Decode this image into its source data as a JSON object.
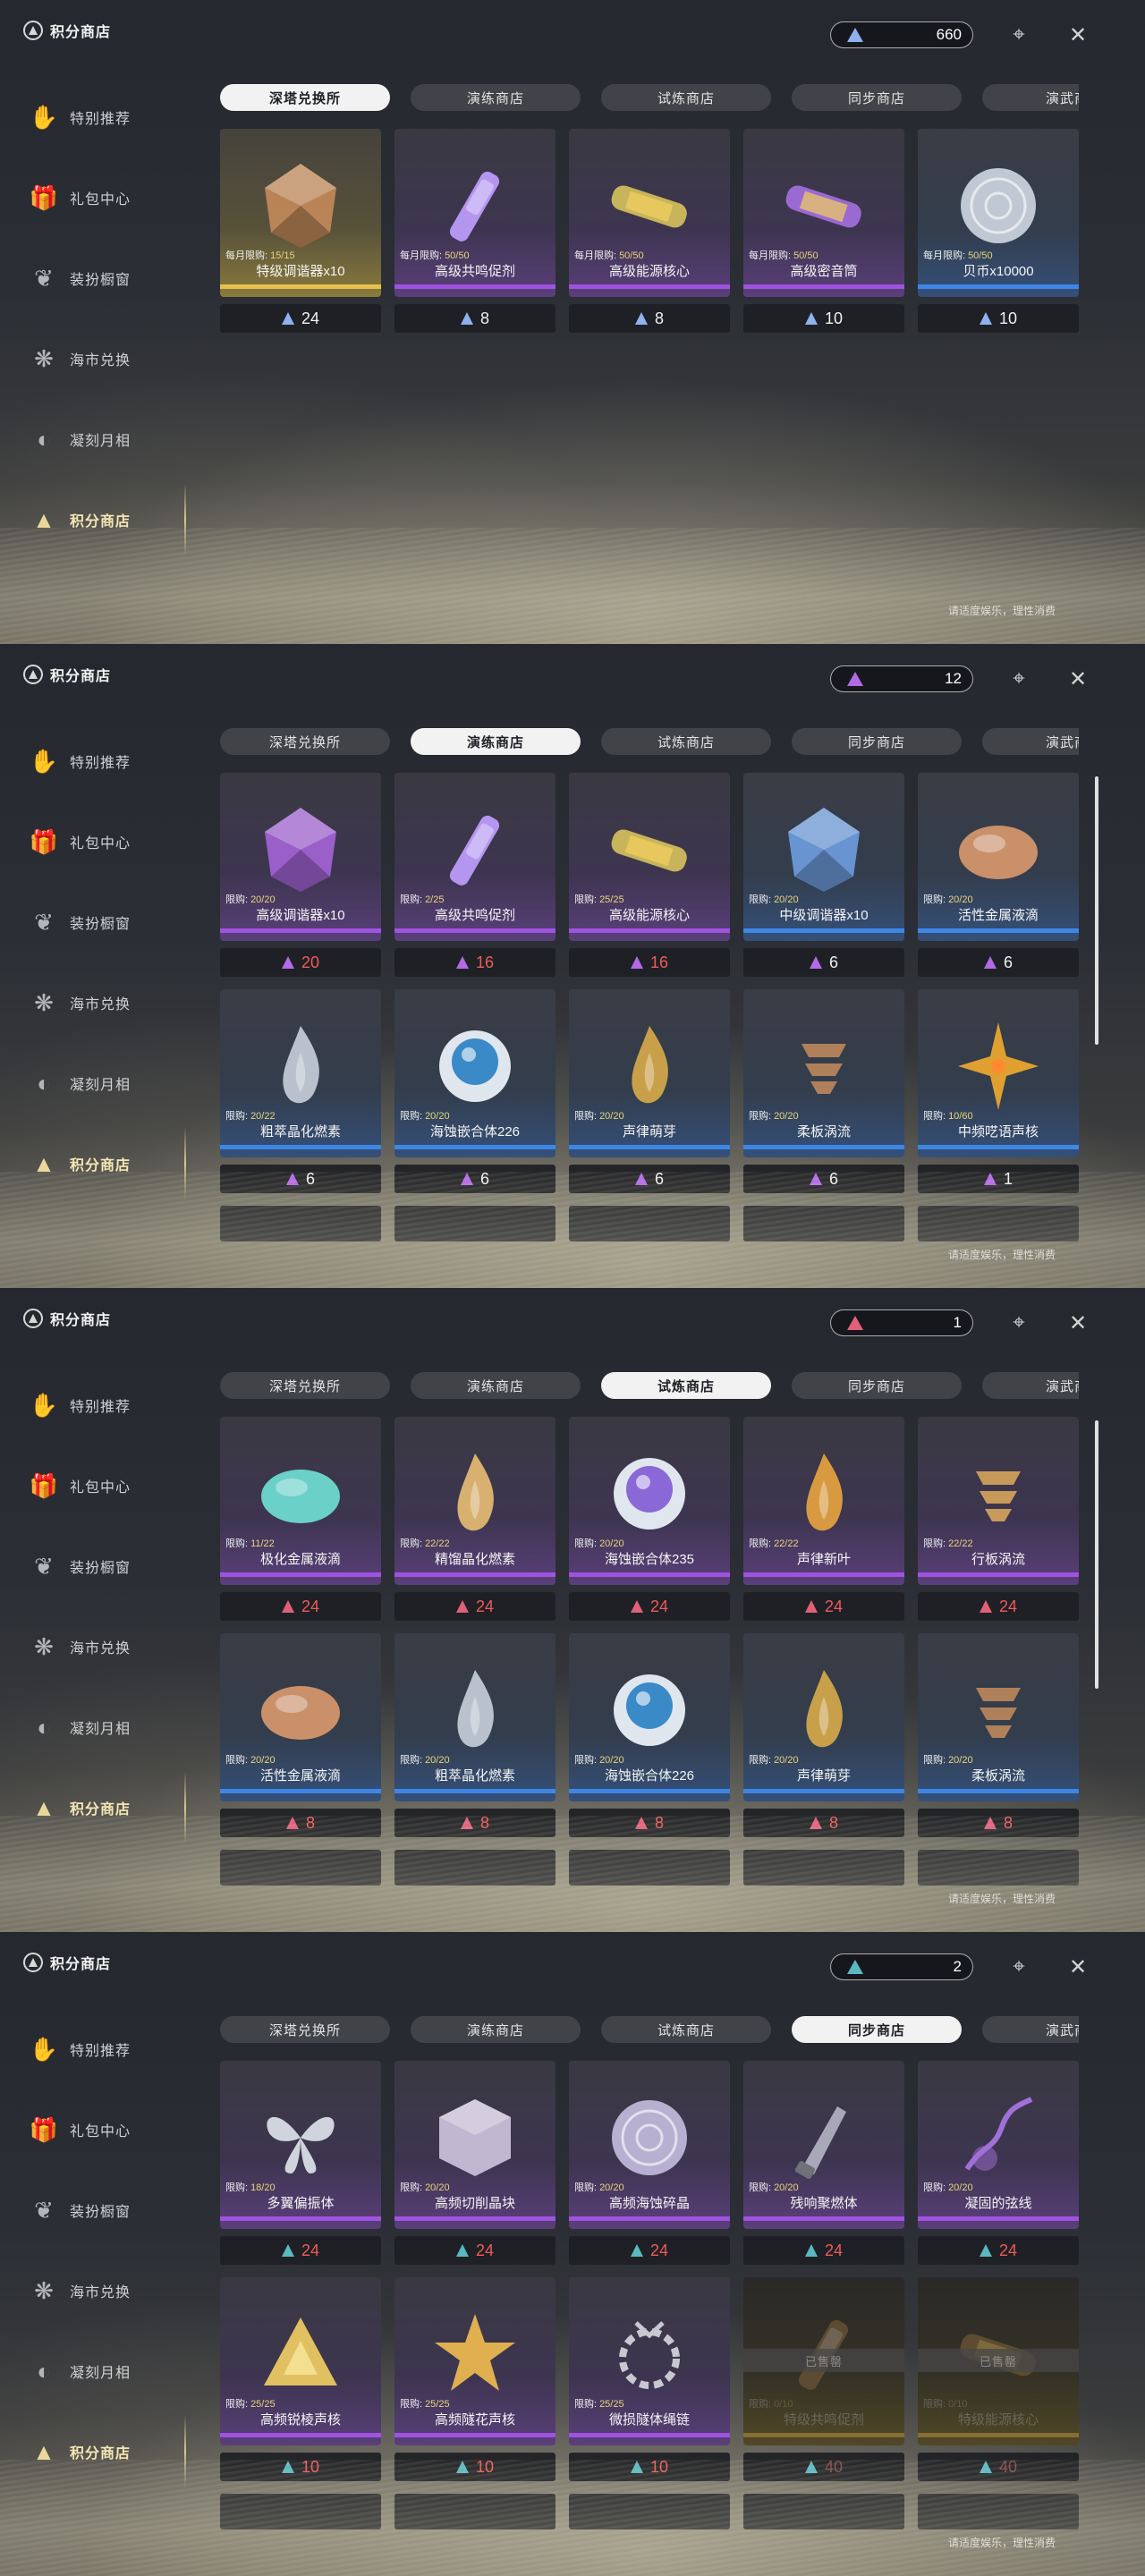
{
  "title": "积分商店",
  "sidebar": [
    {
      "label": "特别推荐",
      "icon": "hand-icon"
    },
    {
      "label": "礼包中心",
      "icon": "gift-icon"
    },
    {
      "label": "装扮橱窗",
      "icon": "outfit-icon"
    },
    {
      "label": "海市兑换",
      "icon": "coral-icon"
    },
    {
      "label": "凝刻月相",
      "icon": "moon-icon"
    },
    {
      "label": "积分商店",
      "icon": "triangle-emblem-icon",
      "active": true
    }
  ],
  "tabs": [
    "深塔兑换所",
    "演练商店",
    "试炼商店",
    "同步商店",
    "演武商"
  ],
  "footer_note": "请适度娱乐，理性消费",
  "screens": [
    {
      "currency": {
        "value": "660",
        "color": "#8fb2ee"
      },
      "active_tab": 0,
      "cards": [
        {
          "name": "特级调谐器x10",
          "limit_label": "每月限购:",
          "limit": "15/15",
          "price": "24",
          "rarity": "gold",
          "icon": "gold-tuner-icon",
          "icon_color": "#c48a5a"
        },
        {
          "name": "高级共鸣促剂",
          "limit_label": "每月限购:",
          "limit": "50/50",
          "price": "8",
          "rarity": "purple",
          "icon": "resonance-vial-icon",
          "icon_color": "#b496f0"
        },
        {
          "name": "高级能源核心",
          "limit_label": "每月限购:",
          "limit": "50/50",
          "price": "8",
          "rarity": "purple",
          "icon": "energy-core-icon",
          "icon_color": "#c8b45a"
        },
        {
          "name": "高级密音筒",
          "limit_label": "每月限购:",
          "limit": "50/50",
          "price": "10",
          "rarity": "purple",
          "icon": "sonic-tube-icon",
          "icon_color": "#9a6ad2"
        },
        {
          "name": "贝币x10000",
          "limit_label": "每月限购:",
          "limit": "50/50",
          "price": "10",
          "rarity": "blue",
          "icon": "shell-coin-icon",
          "icon_color": "#c0c8d4"
        }
      ],
      "price_color": "#8fb2ee",
      "price_red": false,
      "stub_row": false,
      "show_scroll": false
    },
    {
      "currency": {
        "value": "12",
        "color": "#b26ae6"
      },
      "active_tab": 1,
      "cards": [
        {
          "name": "高级调谐器x10",
          "limit_label": "限购:",
          "limit": "20/20",
          "price": "20",
          "rarity": "purple",
          "icon": "purple-tuner-icon",
          "icon_color": "#a564d8"
        },
        {
          "name": "高级共鸣促剂",
          "limit_label": "限购:",
          "limit": "2/25",
          "price": "16",
          "rarity": "purple",
          "icon": "resonance-vial-icon",
          "icon_color": "#b496f0"
        },
        {
          "name": "高级能源核心",
          "limit_label": "限购:",
          "limit": "25/25",
          "price": "16",
          "rarity": "purple",
          "icon": "energy-core-icon",
          "icon_color": "#c8b45a"
        },
        {
          "name": "中级调谐器x10",
          "limit_label": "限购:",
          "limit": "20/20",
          "price": "6",
          "rarity": "blue",
          "icon": "blue-tuner-icon",
          "icon_color": "#6e9ee0"
        },
        {
          "name": "活性金属液滴",
          "limit_label": "限购:",
          "limit": "20/20",
          "price": "6",
          "rarity": "blue",
          "icon": "metal-droplet-icon",
          "icon_color": "#c9906a"
        },
        {
          "name": "粗萃晶化燃素",
          "limit_label": "限购:",
          "limit": "20/22",
          "price": "6",
          "rarity": "blue",
          "icon": "crystal-flame-icon",
          "icon_color": "#b9c2cc"
        },
        {
          "name": "海蚀嵌合体226",
          "limit_label": "限购:",
          "limit": "20/20",
          "price": "6",
          "rarity": "blue",
          "icon": "chimera-orb-icon",
          "icon_color": "#3a8ac8"
        },
        {
          "name": "声律萌芽",
          "limit_label": "限购:",
          "limit": "20/20",
          "price": "6",
          "rarity": "blue",
          "icon": "sprout-icon",
          "icon_color": "#c8a04a"
        },
        {
          "name": "柔板涡流",
          "limit_label": "限购:",
          "limit": "20/20",
          "price": "6",
          "rarity": "blue",
          "icon": "vortex-icon",
          "icon_color": "#b0805a"
        },
        {
          "name": "中频呓语声核",
          "limit_label": "限购:",
          "limit": "10/60",
          "price": "1",
          "rarity": "blue",
          "icon": "star-core-icon",
          "icon_color": "#e0a030"
        }
      ],
      "price_color": "#b26ae6",
      "price_red": true,
      "price_red_first_n": 3,
      "stub_row": true,
      "show_scroll": true
    },
    {
      "currency": {
        "value": "1",
        "color": "#e0607a"
      },
      "active_tab": 2,
      "cards": [
        {
          "name": "极化金属液滴",
          "limit_label": "限购:",
          "limit": "11/22",
          "price": "24",
          "rarity": "purple",
          "icon": "iridescent-droplet-icon",
          "icon_color": "#6ad0c8"
        },
        {
          "name": "精馏晶化燃素",
          "limit_label": "限购:",
          "limit": "22/22",
          "price": "24",
          "rarity": "purple",
          "icon": "amber-flame-icon",
          "icon_color": "#d8b070"
        },
        {
          "name": "海蚀嵌合体235",
          "limit_label": "限购:",
          "limit": "20/20",
          "price": "24",
          "rarity": "purple",
          "icon": "purple-orb-icon",
          "icon_color": "#8a68d8"
        },
        {
          "name": "声律新叶",
          "limit_label": "限购:",
          "limit": "22/22",
          "price": "24",
          "rarity": "purple",
          "icon": "new-leaf-icon",
          "icon_color": "#d89a40"
        },
        {
          "name": "行板涡流",
          "limit_label": "限购:",
          "limit": "22/22",
          "price": "24",
          "rarity": "purple",
          "icon": "spiral-icon",
          "icon_color": "#c89a5a"
        },
        {
          "name": "活性金属液滴",
          "limit_label": "限购:",
          "limit": "20/20",
          "price": "8",
          "rarity": "blue",
          "icon": "metal-droplet-icon",
          "icon_color": "#c9906a"
        },
        {
          "name": "粗萃晶化燃素",
          "limit_label": "限购:",
          "limit": "20/20",
          "price": "8",
          "rarity": "blue",
          "icon": "crystal-flame-icon",
          "icon_color": "#b9c2cc"
        },
        {
          "name": "海蚀嵌合体226",
          "limit_label": "限购:",
          "limit": "20/20",
          "price": "8",
          "rarity": "blue",
          "icon": "chimera-orb-icon",
          "icon_color": "#3a8ac8"
        },
        {
          "name": "声律萌芽",
          "limit_label": "限购:",
          "limit": "20/20",
          "price": "8",
          "rarity": "blue",
          "icon": "sprout-icon",
          "icon_color": "#c8a04a"
        },
        {
          "name": "柔板涡流",
          "limit_label": "限购:",
          "limit": "20/20",
          "price": "8",
          "rarity": "blue",
          "icon": "vortex-icon",
          "icon_color": "#b0805a"
        }
      ],
      "price_color": "#e0607a",
      "price_red": true,
      "price_red_first_n": 10,
      "stub_row": true,
      "show_scroll": true
    },
    {
      "currency": {
        "value": "2",
        "color": "#5ab8c0"
      },
      "active_tab": 3,
      "cards": [
        {
          "name": "多翼偏振体",
          "limit_label": "限购:",
          "limit": "18/20",
          "price": "24",
          "rarity": "purple",
          "icon": "butterfly-icon",
          "icon_color": "#d0d4dc"
        },
        {
          "name": "高频切削晶块",
          "limit_label": "限购:",
          "limit": "20/20",
          "price": "24",
          "rarity": "purple",
          "icon": "crystal-cube-icon",
          "icon_color": "#c0b8d0"
        },
        {
          "name": "高频海蚀碎晶",
          "limit_label": "限购:",
          "limit": "20/20",
          "price": "24",
          "rarity": "purple",
          "icon": "shard-disc-icon",
          "icon_color": "#b8b0d0"
        },
        {
          "name": "残响聚燃体",
          "limit_label": "限购:",
          "limit": "20/20",
          "price": "24",
          "rarity": "purple",
          "icon": "blade-icon",
          "icon_color": "#a8a8b8"
        },
        {
          "name": "凝固的弦线",
          "limit_label": "限购:",
          "limit": "20/20",
          "price": "24",
          "rarity": "purple",
          "icon": "string-icon",
          "icon_color": "#a070d8"
        },
        {
          "name": "高频锐棱声核",
          "limit_label": "限购:",
          "limit": "25/25",
          "price": "10",
          "rarity": "purple",
          "icon": "prism-core-icon",
          "icon_color": "#e0c060"
        },
        {
          "name": "高频隧花声核",
          "limit_label": "限购:",
          "limit": "25/25",
          "price": "10",
          "rarity": "purple",
          "icon": "flower-core-icon",
          "icon_color": "#e0b050"
        },
        {
          "name": "微损隧体绳链",
          "limit_label": "限购:",
          "limit": "25/25",
          "price": "10",
          "rarity": "purple",
          "icon": "chain-icon",
          "icon_color": "#c8c8d0"
        },
        {
          "name": "特级共鸣促剂",
          "limit_label": "限购:",
          "limit": "0/10",
          "price": "40",
          "rarity": "gold",
          "icon": "gold-vial-icon",
          "icon_color": "#a08050",
          "sold_out": "已售罄"
        },
        {
          "name": "特级能源核心",
          "limit_label": "限购:",
          "limit": "0/10",
          "price": "40",
          "rarity": "gold",
          "icon": "gold-core-icon",
          "icon_color": "#a08050",
          "sold_out": "已售罄"
        }
      ],
      "price_color": "#5ab8c0",
      "price_red": true,
      "price_red_first_n": 10,
      "stub_row": true,
      "show_scroll": false
    }
  ]
}
